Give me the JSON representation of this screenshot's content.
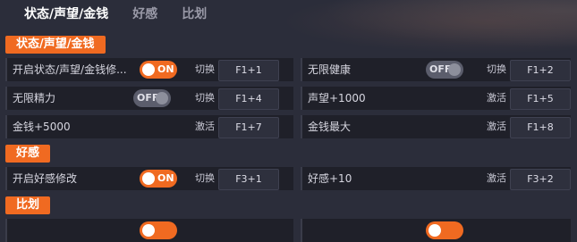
{
  "tabs": [
    {
      "label": "状态/声望/金钱"
    },
    {
      "label": "好感"
    },
    {
      "label": "比划"
    }
  ],
  "sections": [
    {
      "title": "状态/声望/金钱"
    },
    {
      "title": "好感"
    },
    {
      "title": "比划"
    }
  ],
  "options": [
    {
      "label": "开启状态/声望/金钱修...",
      "toggle": "ON",
      "action": "切换",
      "key": "F1+1"
    },
    {
      "label": "无限健康",
      "toggle": "OFF",
      "action": "切换",
      "key": "F1+2"
    },
    {
      "label": "无限精力",
      "toggle": "OFF",
      "action": "切换",
      "key": "F1+4"
    },
    {
      "label": "声望+1000",
      "action": "激活",
      "key": "F1+5"
    },
    {
      "label": "金钱+5000",
      "action": "激活",
      "key": "F1+7"
    },
    {
      "label": "金钱最大",
      "action": "激活",
      "key": "F1+8"
    },
    {
      "label": "开启好感修改",
      "toggle": "ON",
      "action": "切换",
      "key": "F3+1"
    },
    {
      "label": "好感+10",
      "action": "激活",
      "key": "F3+2"
    }
  ],
  "colors": {
    "accent": "#f06a21",
    "background": "#2b2d3a",
    "row": "#1f2029"
  }
}
